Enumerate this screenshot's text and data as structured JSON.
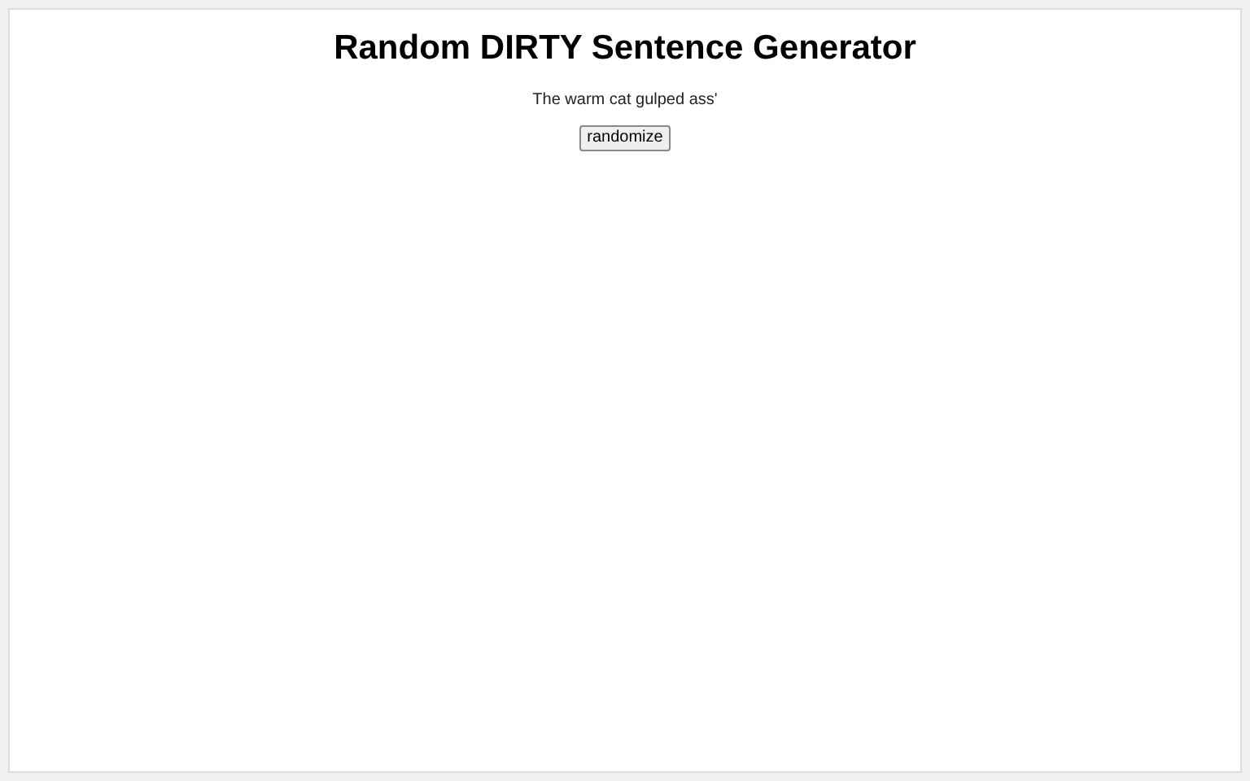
{
  "title": "Random DIRTY Sentence Generator",
  "sentence": "The warm cat gulped ass'",
  "button": "randomize"
}
